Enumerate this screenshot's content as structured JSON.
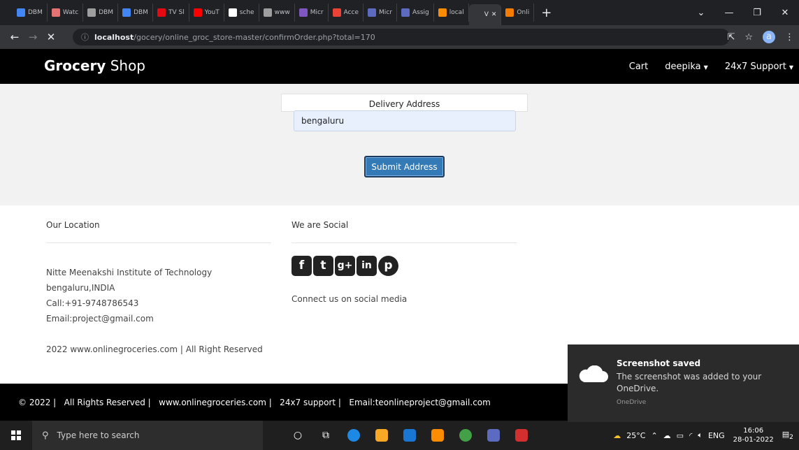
{
  "browser": {
    "tabs": [
      {
        "label": "DBM",
        "color": "#4285f4"
      },
      {
        "label": "Watc",
        "color": "#e57373"
      },
      {
        "label": "DBM",
        "color": "#9e9e9e"
      },
      {
        "label": "DBM",
        "color": "#4285f4"
      },
      {
        "label": "TV Sl",
        "color": "#e50914"
      },
      {
        "label": "YouT",
        "color": "#ff0000"
      },
      {
        "label": "sche",
        "color": "#ffffff"
      },
      {
        "label": "www",
        "color": "#9e9e9e"
      },
      {
        "label": "Micr",
        "color": "#7e57c2"
      },
      {
        "label": "Acce",
        "color": "#ea4335"
      },
      {
        "label": "Micr",
        "color": "#5c6bc0"
      },
      {
        "label": "Assig",
        "color": "#5c6bc0"
      },
      {
        "label": "local",
        "color": "#fb8c00"
      },
      {
        "label": "V",
        "color": "#35363a"
      },
      {
        "label": "Onli",
        "color": "#f57c00"
      }
    ],
    "new_tab": "+",
    "url_host": "localhost",
    "url_path": "/gocery/online_groc_store-master/confirmOrder.php?total=170"
  },
  "site": {
    "brand_bold": "Grocery",
    "brand_rest": " Shop",
    "nav": {
      "cart": "Cart",
      "user": "deepika",
      "support": "24x7 Support"
    }
  },
  "form": {
    "title": "Delivery Address",
    "address_value": "bengaluru",
    "submit_label": "Submit Address"
  },
  "footer": {
    "location_title": "Our Location",
    "social_title": "We are Social",
    "address_lines": [
      "Nitte Meenakshi Institute of Technology",
      "bengaluru,INDIA",
      "Call:+91-9748786543",
      "Email:project@gmail.com"
    ],
    "copyright_line": "2022 www.onlinegroceries.com | All Right Reserved",
    "social_caption": "Connect us on social media",
    "social_icons": [
      "f",
      "t",
      "g+",
      "in",
      "p"
    ],
    "bottom_text": "© 2022 |   All Rights Reserved |   www.onlinegroceries.com |   24x7 support |   Email:teonlineproject@gmail.com"
  },
  "toast": {
    "title": "Screenshot saved",
    "message": "The screenshot was added to your OneDrive.",
    "source": "OneDrive"
  },
  "taskbar": {
    "search_placeholder": "Type here to search",
    "weather": "25°C",
    "language": "ENG",
    "time": "16:06",
    "date": "28-01-2022",
    "notification_count": "2"
  }
}
